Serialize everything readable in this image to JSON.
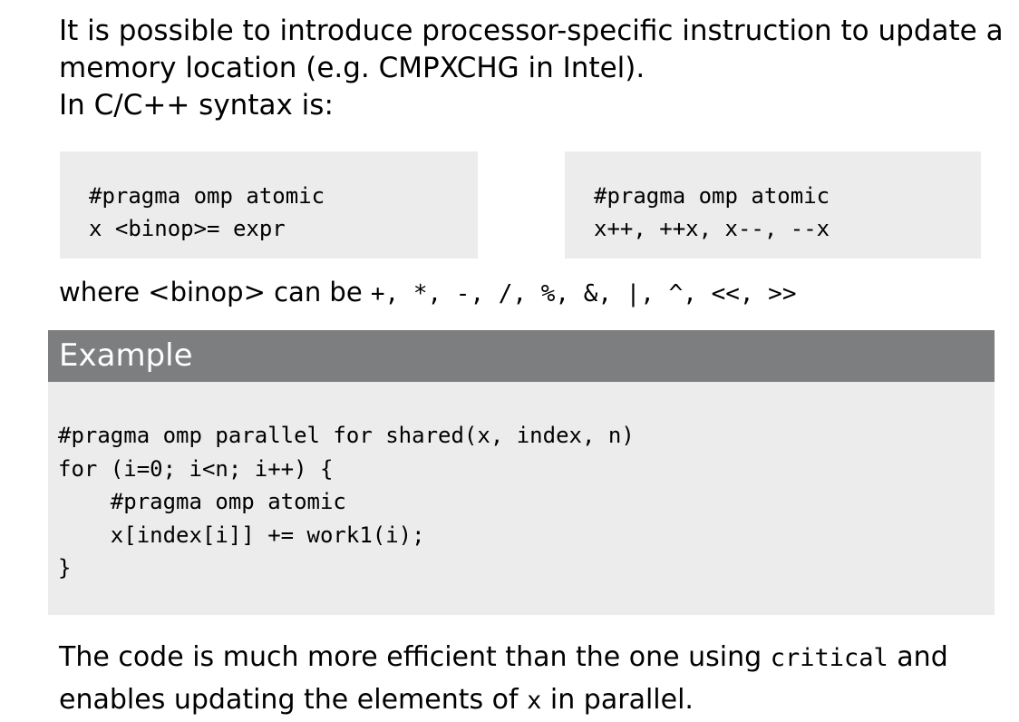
{
  "intro": {
    "line1": "It is possible to introduce processor-specific instruction to update a",
    "line2": "memory location (e.g. CMPXCHG in Intel).",
    "line3": "In C/C++ syntax is:"
  },
  "code_box_left": {
    "line1": "#pragma omp atomic",
    "line2": "x <binop>= expr"
  },
  "code_box_right": {
    "line1": "#pragma omp atomic",
    "line2": "x++, ++x, x--, --x"
  },
  "binop_note": {
    "prefix": "where <binop> can be ",
    "operators": "+, *, -, /, %, &, |, ^, <<, >>"
  },
  "example": {
    "title": "Example",
    "code_lines": [
      "#pragma omp parallel for shared(x, index, n)",
      "for (i=0; i<n; i++) {",
      "    #pragma omp atomic",
      "    x[index[i]] += work1(i);",
      "}"
    ]
  },
  "outro": {
    "part1": "The code is much more efficient than the one using ",
    "keyword": "critical",
    "part2": " and",
    "part3": "enables updating the elements of ",
    "var": "x",
    "part4": " in parallel."
  }
}
